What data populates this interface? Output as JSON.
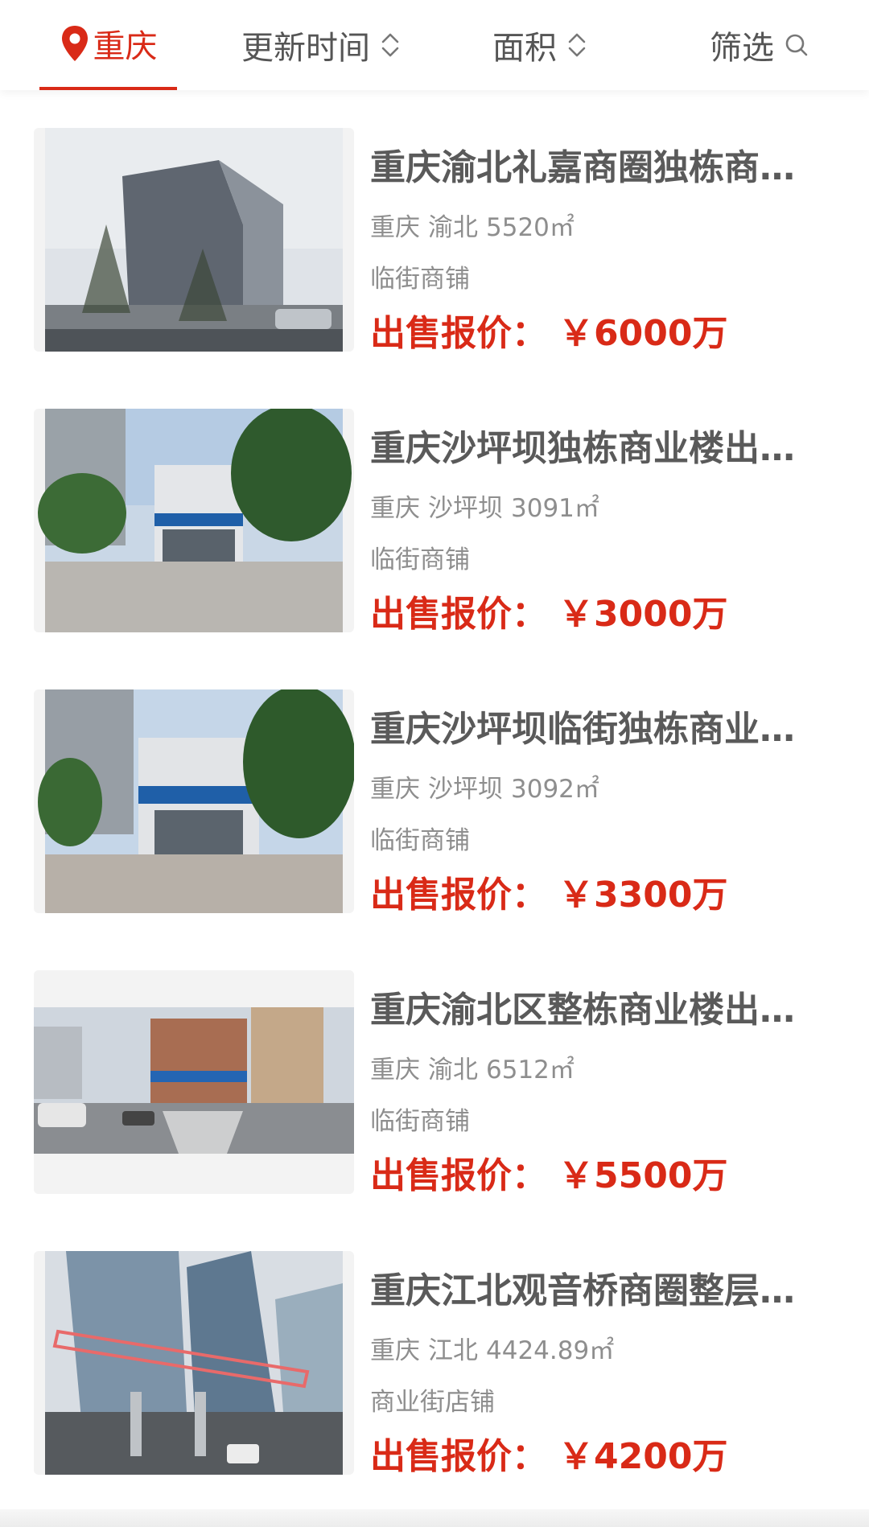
{
  "header": {
    "city": "重庆",
    "sort_updated_label": "更新时间",
    "sort_area_label": "面积",
    "filter_label": "筛选",
    "active_color": "#d92a17"
  },
  "listings": [
    {
      "title": "重庆渝北礼嘉商圈独栋商…",
      "city": "重庆",
      "district": "渝北",
      "area": "5520㎡",
      "type": "临街商铺",
      "price_label": "出售报价：",
      "price": "￥6000万"
    },
    {
      "title": "重庆沙坪坝独栋商业楼出…",
      "city": "重庆",
      "district": "沙坪坝",
      "area": "3091㎡",
      "type": "临街商铺",
      "price_label": "出售报价：",
      "price": "￥3000万"
    },
    {
      "title": "重庆沙坪坝临街独栋商业…",
      "city": "重庆",
      "district": "沙坪坝",
      "area": "3092㎡",
      "type": "临街商铺",
      "price_label": "出售报价：",
      "price": "￥3300万"
    },
    {
      "title": "重庆渝北区整栋商业楼出…",
      "city": "重庆",
      "district": "渝北",
      "area": "6512㎡",
      "type": "临街商铺",
      "price_label": "出售报价：",
      "price": "￥5500万"
    },
    {
      "title": "重庆江北观音桥商圈整层…",
      "city": "重庆",
      "district": "江北",
      "area": "4424.89㎡",
      "type": "商业街店铺",
      "price_label": "出售报价：",
      "price": "￥4200万"
    }
  ]
}
